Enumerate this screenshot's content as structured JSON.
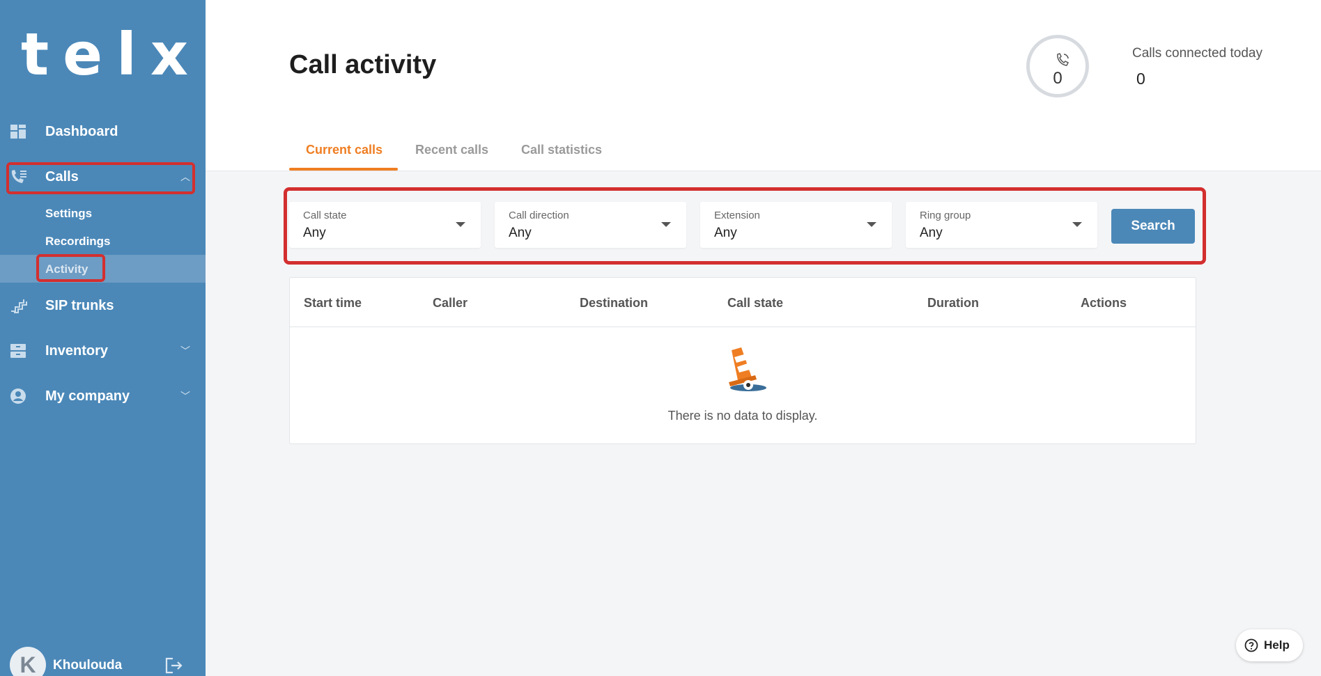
{
  "sidebar": {
    "logo": "telxi",
    "items": [
      {
        "label": "Dashboard",
        "icon": "dashboard-icon"
      },
      {
        "label": "Calls",
        "icon": "calls-icon"
      },
      {
        "label": "SIP trunks",
        "icon": "sip-trunks-icon"
      },
      {
        "label": "Inventory",
        "icon": "inventory-icon"
      },
      {
        "label": "My company",
        "icon": "company-icon"
      }
    ],
    "calls_sub": [
      "Settings",
      "Recordings",
      "Activity"
    ],
    "user": {
      "initial": "K",
      "name": "Khoulouda"
    }
  },
  "header": {
    "title": "Call activity",
    "stat": {
      "value_in_gauge": "0",
      "label": "Calls connected today",
      "value": "0"
    },
    "tabs": [
      "Current calls",
      "Recent calls",
      "Call statistics"
    ]
  },
  "filters": [
    {
      "label": "Call state",
      "value": "Any"
    },
    {
      "label": "Call direction",
      "value": "Any"
    },
    {
      "label": "Extension",
      "value": "Any"
    },
    {
      "label": "Ring group",
      "value": "Any"
    }
  ],
  "search_label": "Search",
  "table": {
    "columns": [
      "Start time",
      "Caller",
      "Destination",
      "Call state",
      "Duration",
      "Actions"
    ],
    "empty_text": "There is no data to display."
  },
  "help_label": "Help",
  "colors": {
    "sidebar": "#4b88b8",
    "accent": "#ef7e22",
    "highlight": "#d32f2f"
  }
}
